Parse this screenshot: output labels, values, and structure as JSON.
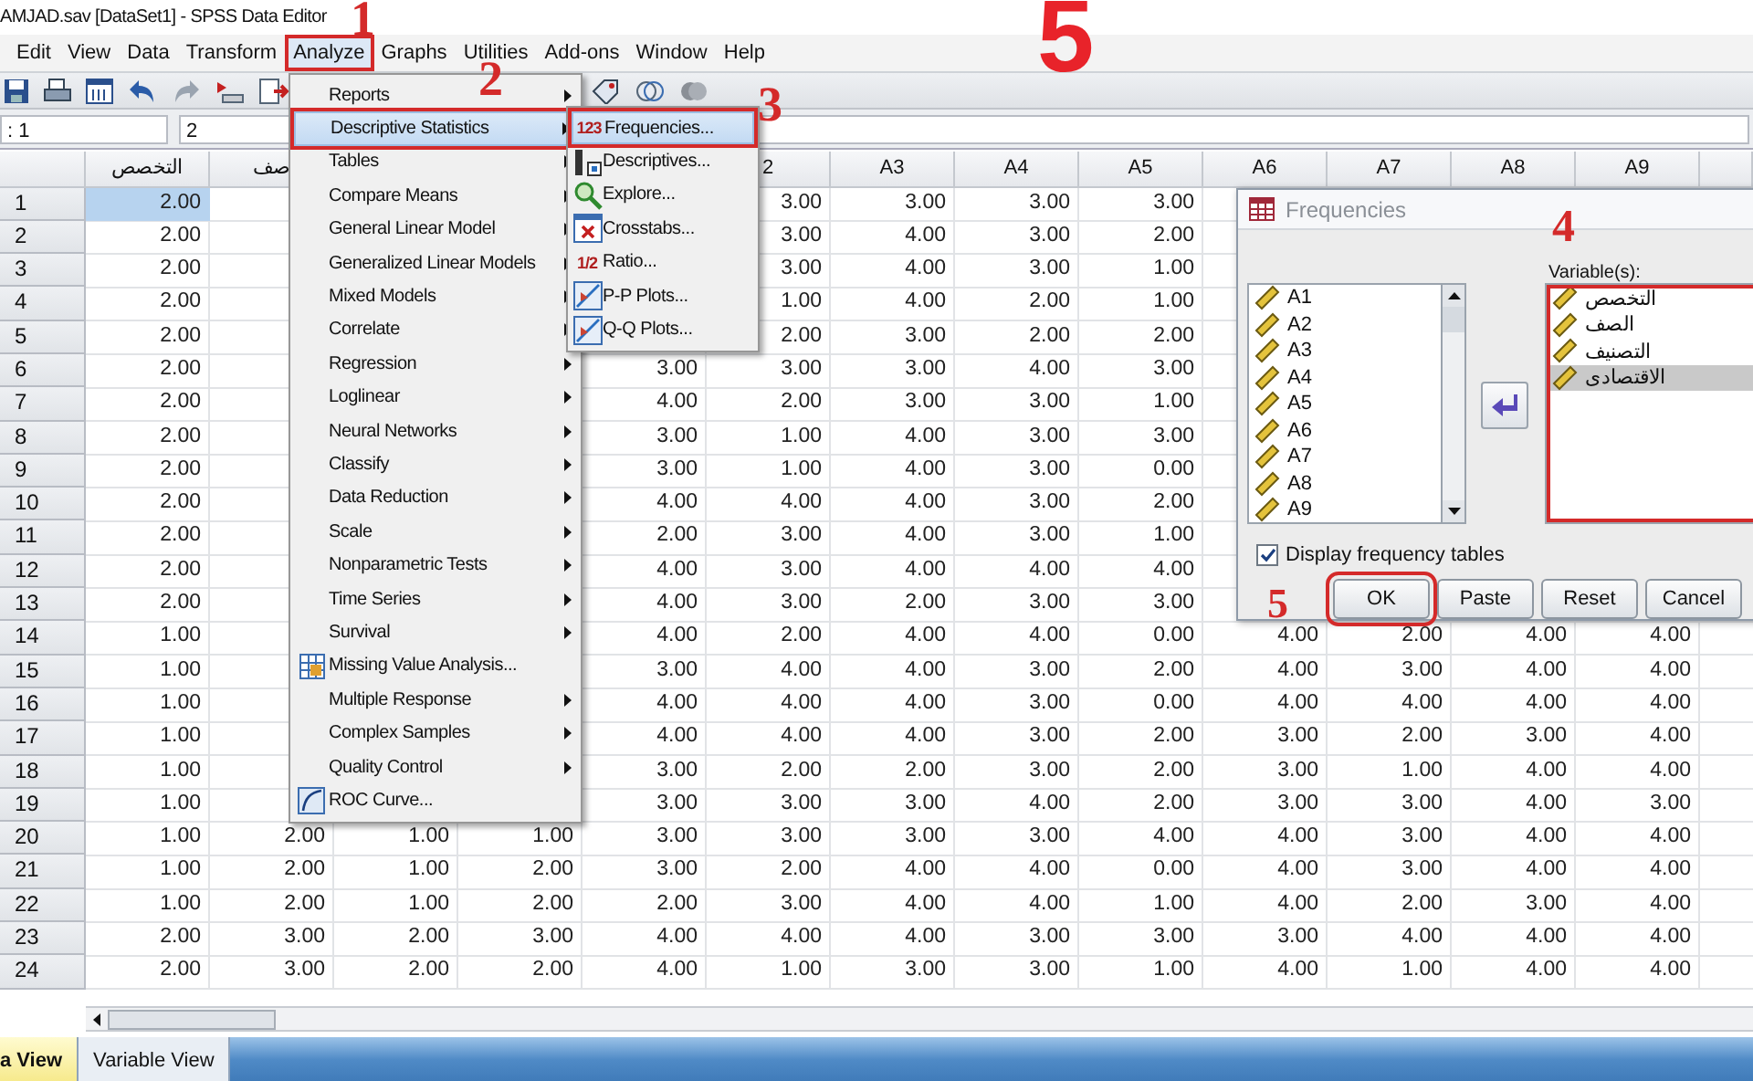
{
  "window": {
    "title": "AMJAD.sav [DataSet1] - SPSS Data Editor"
  },
  "menu_bar": [
    {
      "label": "Edit",
      "selected": false,
      "outlined": false
    },
    {
      "label": "View",
      "selected": false,
      "outlined": false
    },
    {
      "label": "Data",
      "selected": false,
      "outlined": false
    },
    {
      "label": "Transform",
      "selected": false,
      "outlined": false
    },
    {
      "label": "Analyze",
      "selected": true,
      "outlined": true
    },
    {
      "label": "Graphs",
      "selected": false,
      "outlined": false
    },
    {
      "label": "Utilities",
      "selected": false,
      "outlined": false
    },
    {
      "label": "Add-ons",
      "selected": false,
      "outlined": false
    },
    {
      "label": "Window",
      "selected": false,
      "outlined": false
    },
    {
      "label": "Help",
      "selected": false,
      "outlined": false
    }
  ],
  "cell_bar": {
    "cell_name": ": 1",
    "cell_value": "2"
  },
  "grid": {
    "columns": [
      "التخصص",
      "صف",
      null,
      null,
      null,
      "2",
      "A3",
      "A4",
      "A5",
      "A6",
      "A7",
      "A8",
      "A9"
    ],
    "rows": [
      {
        "number": "1",
        "cells": [
          {
            "value": "2.00",
            "selected": true
          },
          null,
          null,
          null,
          null,
          "3.00",
          "3.00",
          "3.00",
          "3.00",
          null,
          null,
          null,
          null
        ]
      },
      {
        "number": "2",
        "cells": [
          "2.00",
          null,
          null,
          null,
          null,
          "3.00",
          "4.00",
          "3.00",
          "2.00",
          null,
          null,
          null,
          null
        ]
      },
      {
        "number": "3",
        "cells": [
          "2.00",
          null,
          null,
          null,
          null,
          "3.00",
          "4.00",
          "3.00",
          "1.00",
          null,
          null,
          null,
          null
        ]
      },
      {
        "number": "4",
        "cells": [
          "2.00",
          null,
          null,
          null,
          null,
          "1.00",
          "4.00",
          "2.00",
          "1.00",
          null,
          null,
          null,
          null
        ]
      },
      {
        "number": "5",
        "cells": [
          "2.00",
          null,
          null,
          null,
          null,
          "2.00",
          "3.00",
          "2.00",
          "2.00",
          null,
          null,
          null,
          null
        ]
      },
      {
        "number": "6",
        "cells": [
          "2.00",
          null,
          null,
          null,
          "3.00",
          "3.00",
          "3.00",
          "4.00",
          "3.00",
          null,
          null,
          null,
          null
        ]
      },
      {
        "number": "7",
        "cells": [
          "2.00",
          null,
          null,
          null,
          "4.00",
          "2.00",
          "3.00",
          "3.00",
          "1.00",
          null,
          null,
          null,
          null
        ]
      },
      {
        "number": "8",
        "cells": [
          "2.00",
          null,
          null,
          null,
          "3.00",
          "1.00",
          "4.00",
          "3.00",
          "3.00",
          null,
          null,
          null,
          null
        ]
      },
      {
        "number": "9",
        "cells": [
          "2.00",
          null,
          null,
          null,
          "3.00",
          "1.00",
          "4.00",
          "3.00",
          "0.00",
          null,
          null,
          null,
          null
        ]
      },
      {
        "number": "10",
        "cells": [
          "2.00",
          null,
          null,
          null,
          "4.00",
          "4.00",
          "4.00",
          "3.00",
          "2.00",
          null,
          null,
          null,
          null
        ]
      },
      {
        "number": "11",
        "cells": [
          "2.00",
          null,
          null,
          null,
          "2.00",
          "3.00",
          "4.00",
          "3.00",
          "1.00",
          null,
          null,
          null,
          null
        ]
      },
      {
        "number": "12",
        "cells": [
          "2.00",
          null,
          null,
          null,
          "4.00",
          "3.00",
          "4.00",
          "4.00",
          "4.00",
          null,
          null,
          null,
          null
        ]
      },
      {
        "number": "13",
        "cells": [
          "2.00",
          null,
          null,
          null,
          "4.00",
          "3.00",
          "2.00",
          "3.00",
          "3.00",
          null,
          null,
          null,
          null
        ]
      },
      {
        "number": "14",
        "cells": [
          "1.00",
          null,
          null,
          null,
          "4.00",
          "2.00",
          "4.00",
          "4.00",
          "0.00",
          "4.00",
          "2.00",
          "4.00",
          "4.00"
        ]
      },
      {
        "number": "15",
        "cells": [
          "1.00",
          null,
          null,
          null,
          "3.00",
          "4.00",
          "4.00",
          "3.00",
          "2.00",
          "4.00",
          "3.00",
          "4.00",
          "4.00"
        ]
      },
      {
        "number": "16",
        "cells": [
          "1.00",
          null,
          null,
          null,
          "4.00",
          "4.00",
          "4.00",
          "3.00",
          "0.00",
          "4.00",
          "4.00",
          "4.00",
          "4.00"
        ]
      },
      {
        "number": "17",
        "cells": [
          "1.00",
          null,
          null,
          null,
          "4.00",
          "4.00",
          "4.00",
          "3.00",
          "2.00",
          "3.00",
          "2.00",
          "3.00",
          "4.00"
        ]
      },
      {
        "number": "18",
        "cells": [
          "1.00",
          null,
          null,
          null,
          "3.00",
          "2.00",
          "2.00",
          "3.00",
          "2.00",
          "3.00",
          "1.00",
          "4.00",
          "4.00"
        ]
      },
      {
        "number": "19",
        "cells": [
          "1.00",
          null,
          null,
          null,
          "3.00",
          "3.00",
          "3.00",
          "4.00",
          "2.00",
          "3.00",
          "3.00",
          "4.00",
          "3.00"
        ]
      },
      {
        "number": "20",
        "cells": [
          "1.00",
          "2.00",
          "1.00",
          "1.00",
          "3.00",
          "3.00",
          "3.00",
          "3.00",
          "4.00",
          "4.00",
          "3.00",
          "4.00",
          "4.00"
        ]
      },
      {
        "number": "21",
        "cells": [
          "1.00",
          "2.00",
          "1.00",
          "2.00",
          "3.00",
          "2.00",
          "4.00",
          "4.00",
          "0.00",
          "4.00",
          "3.00",
          "4.00",
          "4.00"
        ]
      },
      {
        "number": "22",
        "cells": [
          "1.00",
          "2.00",
          "1.00",
          "2.00",
          "2.00",
          "3.00",
          "4.00",
          "4.00",
          "1.00",
          "4.00",
          "2.00",
          "3.00",
          "4.00"
        ]
      },
      {
        "number": "23",
        "cells": [
          "2.00",
          "3.00",
          "2.00",
          "3.00",
          "4.00",
          "4.00",
          "4.00",
          "3.00",
          "3.00",
          "3.00",
          "4.00",
          "4.00",
          "4.00"
        ]
      },
      {
        "number": "24",
        "cells": [
          "2.00",
          "3.00",
          "2.00",
          "2.00",
          "4.00",
          "1.00",
          "3.00",
          "3.00",
          "1.00",
          "4.00",
          "1.00",
          "4.00",
          "4.00"
        ]
      }
    ]
  },
  "analyze_menu": {
    "items": [
      {
        "label": "Reports",
        "kind": "submenu",
        "selected": false,
        "outlined": false
      },
      {
        "label": "Descriptive Statistics",
        "kind": "submenu",
        "selected": true,
        "outlined": true
      },
      {
        "label": "Tables",
        "kind": "submenu",
        "selected": false,
        "outlined": false
      },
      {
        "label": "Compare Means",
        "kind": "submenu",
        "selected": false,
        "outlined": false
      },
      {
        "label": "General Linear Model",
        "kind": "submenu",
        "selected": false,
        "outlined": false
      },
      {
        "label": "Generalized Linear Models",
        "kind": "submenu",
        "selected": false,
        "outlined": false
      },
      {
        "label": "Mixed Models",
        "kind": "submenu",
        "selected": false,
        "outlined": false
      },
      {
        "label": "Correlate",
        "kind": "submenu",
        "selected": false,
        "outlined": false
      },
      {
        "label": "Regression",
        "kind": "submenu",
        "selected": false,
        "outlined": false
      },
      {
        "label": "Loglinear",
        "kind": "submenu",
        "selected": false,
        "outlined": false
      },
      {
        "label": "Neural Networks",
        "kind": "submenu",
        "selected": false,
        "outlined": false
      },
      {
        "label": "Classify",
        "kind": "submenu",
        "selected": false,
        "outlined": false
      },
      {
        "label": "Data Reduction",
        "kind": "submenu",
        "selected": false,
        "outlined": false
      },
      {
        "label": "Scale",
        "kind": "submenu",
        "selected": false,
        "outlined": false
      },
      {
        "label": "Nonparametric Tests",
        "kind": "submenu",
        "selected": false,
        "outlined": false
      },
      {
        "label": "Time Series",
        "kind": "submenu",
        "selected": false,
        "outlined": false
      },
      {
        "label": "Survival",
        "kind": "submenu",
        "selected": false,
        "outlined": false
      },
      {
        "label": "Missing Value Analysis...",
        "kind": "missing",
        "selected": false,
        "outlined": false
      },
      {
        "label": "Multiple Response",
        "kind": "submenu",
        "selected": false,
        "outlined": false
      },
      {
        "label": "Complex Samples",
        "kind": "submenu",
        "selected": false,
        "outlined": false
      },
      {
        "label": "Quality Control",
        "kind": "submenu",
        "selected": false,
        "outlined": false
      },
      {
        "label": "ROC Curve...",
        "kind": "roc",
        "selected": false,
        "outlined": false
      }
    ]
  },
  "submenu": {
    "items": [
      {
        "label": "Frequencies...",
        "kind": "digits",
        "icon_text": "123",
        "selected": true,
        "outlined": true
      },
      {
        "label": "Descriptives...",
        "kind": "descriptives",
        "selected": false,
        "outlined": false
      },
      {
        "label": "Explore...",
        "kind": "explore",
        "selected": false,
        "outlined": false
      },
      {
        "label": "Crosstabs...",
        "kind": "crosstabs",
        "selected": false,
        "outlined": false
      },
      {
        "label": "Ratio...",
        "kind": "digits",
        "icon_text": "1/2",
        "selected": false,
        "outlined": false
      },
      {
        "label": "P-P Plots...",
        "kind": "plot",
        "selected": false,
        "outlined": false
      },
      {
        "label": "Q-Q Plots...",
        "kind": "plot",
        "selected": false,
        "outlined": false
      }
    ]
  },
  "dialog": {
    "title": "Frequencies",
    "source": [
      {
        "label": "A1",
        "selected": false
      },
      {
        "label": "A2",
        "selected": false
      },
      {
        "label": "A3",
        "selected": false
      },
      {
        "label": "A4",
        "selected": false
      },
      {
        "label": "A5",
        "selected": false
      },
      {
        "label": "A6",
        "selected": false
      },
      {
        "label": "A7",
        "selected": false
      },
      {
        "label": "A8",
        "selected": false
      },
      {
        "label": "A9",
        "selected": false
      }
    ],
    "target_label": "Variable(s):",
    "target": [
      {
        "label": "التخصص",
        "selected": false
      },
      {
        "label": "الصف",
        "selected": false
      },
      {
        "label": "التصنيف",
        "selected": false
      },
      {
        "label": "الاقتصادى",
        "selected": true
      }
    ],
    "target_outlined": true,
    "checkbox": {
      "label": "Display frequency tables",
      "checked": true
    },
    "buttons": [
      {
        "label": "OK",
        "outlined": true
      },
      {
        "label": "Paste",
        "outlined": false
      },
      {
        "label": "Reset",
        "outlined": false
      },
      {
        "label": "Cancel",
        "outlined": false
      }
    ]
  },
  "view_tabs": [
    {
      "label": "a View",
      "selected": true
    },
    {
      "label": "Variable View",
      "selected": false
    }
  ],
  "annotations": [
    {
      "label": "1",
      "kind": "small"
    },
    {
      "label": "2",
      "kind": "small"
    },
    {
      "label": "3",
      "kind": "small"
    },
    {
      "label": "4",
      "kind": "small"
    },
    {
      "label": "5",
      "kind": "large"
    },
    {
      "label": "5",
      "kind": "small"
    }
  ]
}
